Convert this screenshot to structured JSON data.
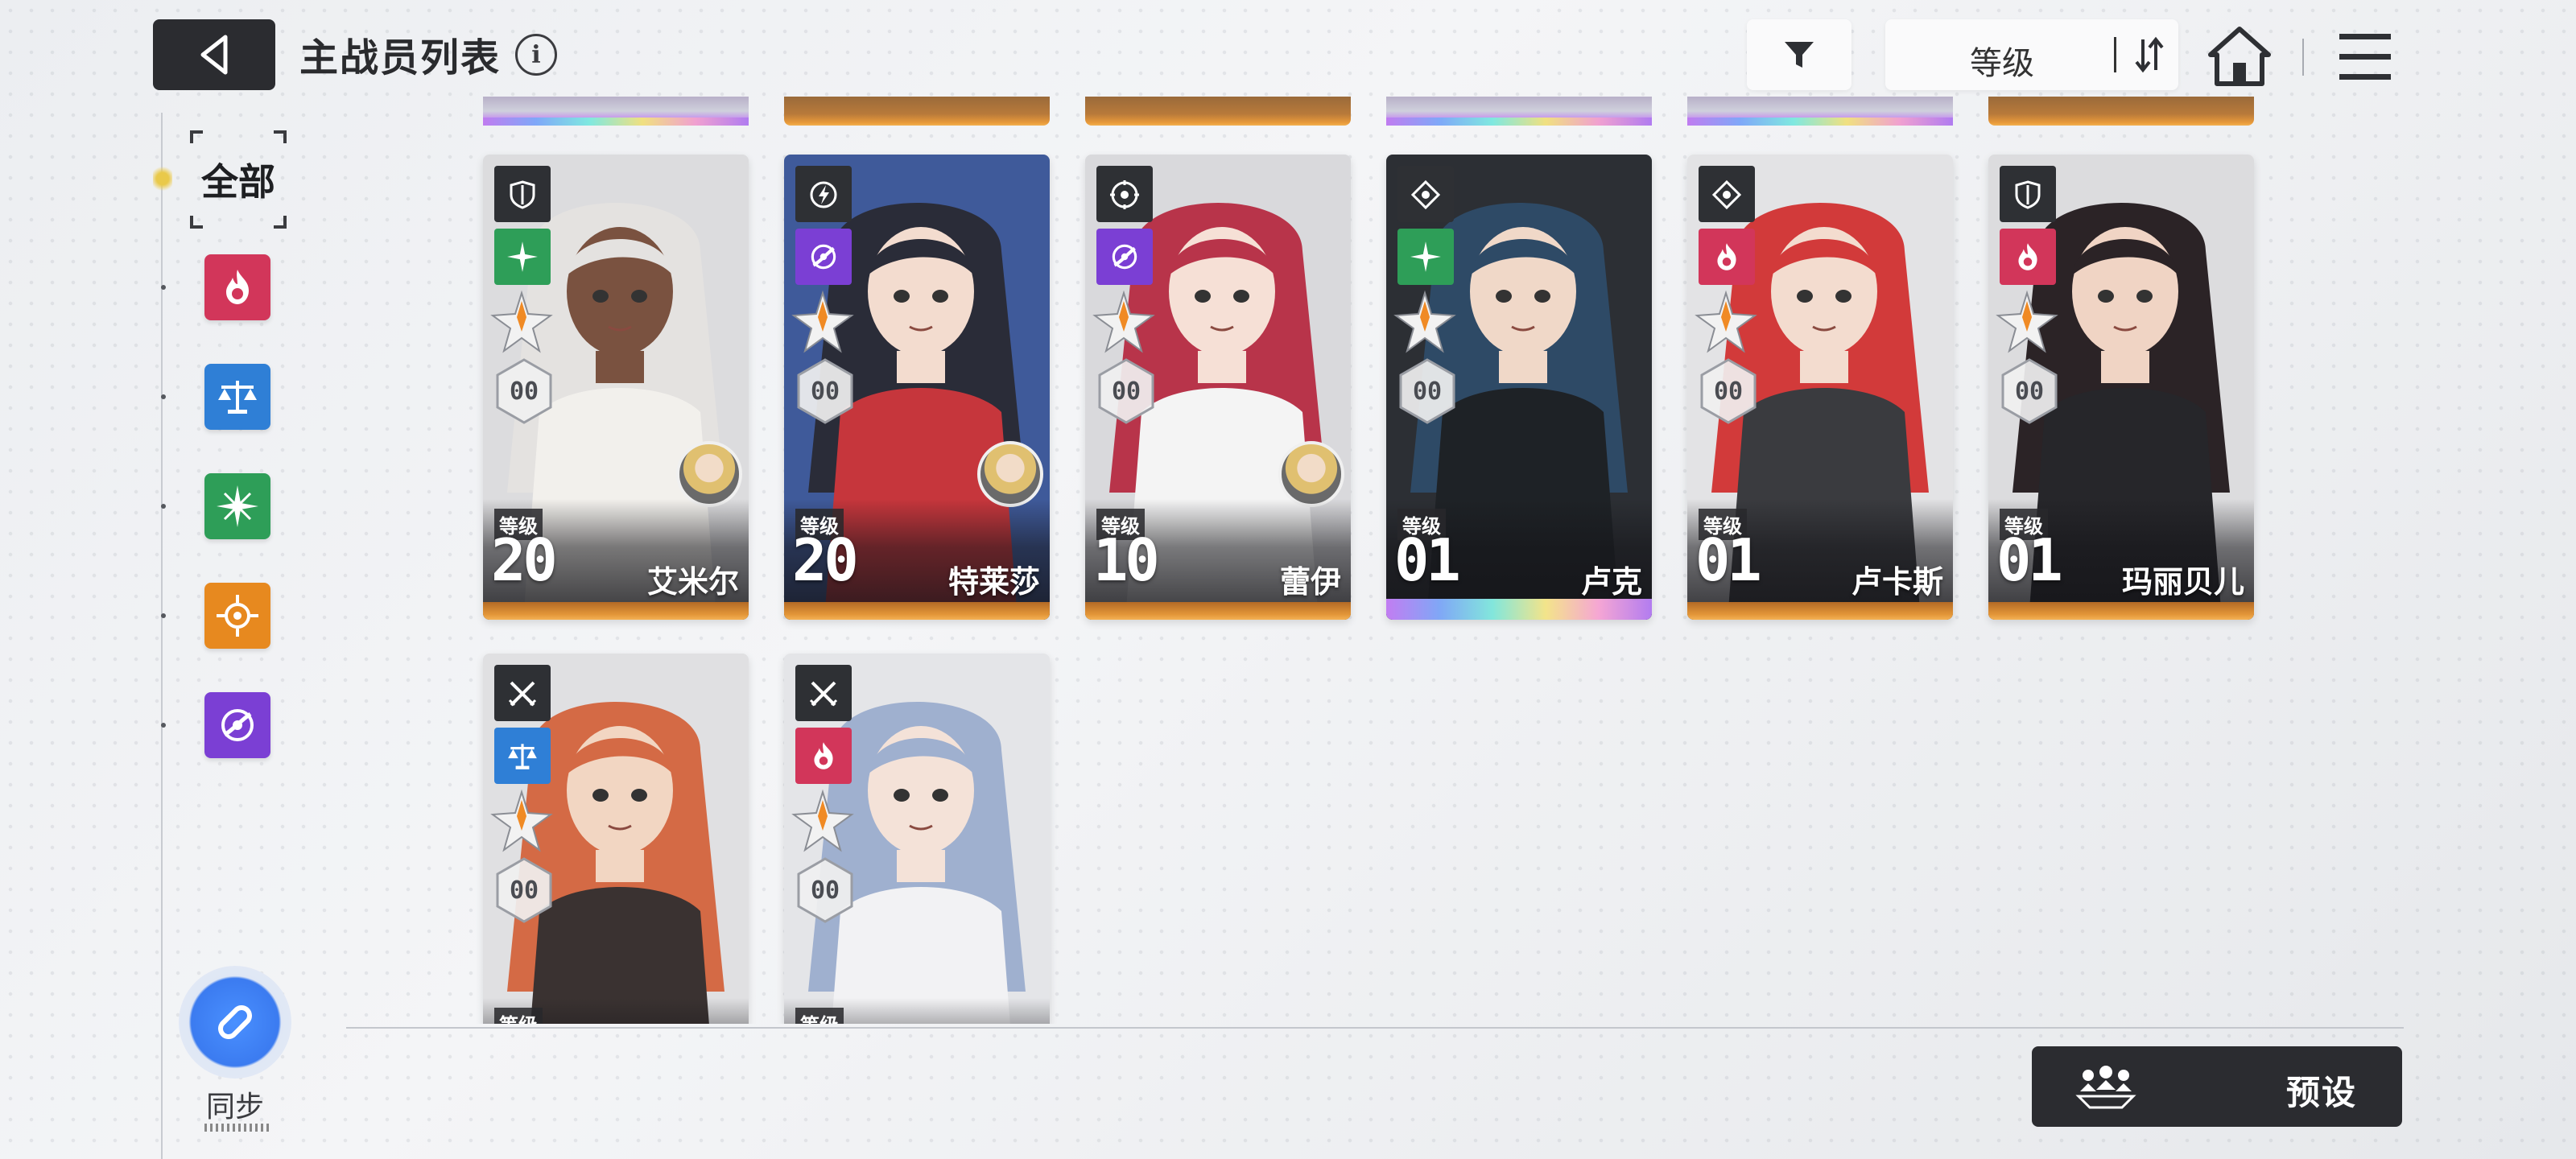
{
  "header": {
    "title": "主战员列表",
    "info_icon": "i",
    "sort_label": "等级",
    "icons": [
      "back-icon",
      "filter-icon",
      "sort-toggle-icon",
      "home-icon",
      "menu-icon"
    ]
  },
  "sidebar": {
    "all_label": "全部",
    "filters": [
      {
        "icon": "fire-element-icon",
        "color": "#d2365a"
      },
      {
        "icon": "balance-element-icon",
        "color": "#2f7fd6"
      },
      {
        "icon": "wind-element-icon",
        "color": "#2e9e58"
      },
      {
        "icon": "light-element-icon",
        "color": "#e7891f"
      },
      {
        "icon": "void-element-icon",
        "color": "#7b3fd4"
      }
    ],
    "sync_label": "同步"
  },
  "level_tag": "等级",
  "operators": [
    {
      "name": "艾米尔",
      "level": "20",
      "constellation": "00",
      "role": "shield-role-icon",
      "element": "wind-element-icon",
      "element_color": "#2e9e58",
      "rarity": "gold"
    },
    {
      "name": "特莱莎",
      "level": "20",
      "constellation": "00",
      "role": "lightning-role-icon",
      "element": "void-element-icon",
      "element_color": "#7b3fd4",
      "rarity": "gold"
    },
    {
      "name": "蕾伊",
      "level": "10",
      "constellation": "00",
      "role": "target-role-icon",
      "element": "void-element-icon",
      "element_color": "#7b3fd4",
      "rarity": "gold"
    },
    {
      "name": "卢克",
      "level": "01",
      "constellation": "00",
      "role": "scope-role-icon",
      "element": "wind-element-icon",
      "element_color": "#2e9e58",
      "rarity": "rainbow"
    },
    {
      "name": "卢卡斯",
      "level": "01",
      "constellation": "00",
      "role": "scope-role-icon",
      "element": "fire-element-icon",
      "element_color": "#d2365a",
      "rarity": "gold"
    },
    {
      "name": "玛丽贝儿",
      "level": "01",
      "constellation": "00",
      "role": "shield-role-icon",
      "element": "fire-element-icon",
      "element_color": "#d2365a",
      "rarity": "gold"
    },
    {
      "name": "",
      "level": "",
      "constellation": "00",
      "role": "swords-role-icon",
      "element": "balance-element-icon",
      "element_color": "#2f7fd6",
      "rarity": "gold"
    },
    {
      "name": "",
      "level": "",
      "constellation": "00",
      "role": "swords-role-icon",
      "element": "fire-element-icon",
      "element_color": "#d2365a",
      "rarity": "gold"
    }
  ],
  "footer": {
    "preset_label": "预设"
  }
}
